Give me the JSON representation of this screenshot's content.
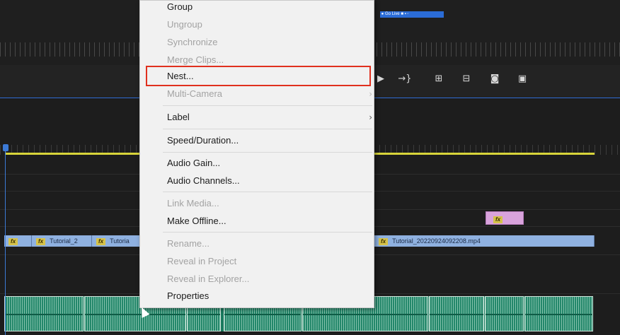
{
  "context_menu": {
    "items": {
      "group": "Group",
      "ungroup": "Ungroup",
      "synchronize": "Synchronize",
      "merge_clips": "Merge Clips...",
      "nest": "Nest...",
      "multi_camera": "Multi-Camera",
      "label": "Label",
      "speed_duration": "Speed/Duration...",
      "audio_gain": "Audio Gain...",
      "audio_channels": "Audio Channels...",
      "link_media": "Link Media...",
      "make_offline": "Make Offline...",
      "rename": "Rename...",
      "reveal_in_project": "Reveal in Project",
      "reveal_in_explorer": "Reveal in Explorer...",
      "properties": "Properties"
    },
    "highlighted_item": "nest",
    "highlight_color": "#e0301e"
  },
  "timeline": {
    "clips": {
      "clip_2": "Tutorial_2",
      "clip_3": "Tutoria",
      "clip_main": "Tutorial_20220924092208.mp4"
    },
    "fx_label": "fx"
  },
  "status_strip": "Go Live",
  "colors": {
    "video_clip": "#8fb1e0",
    "audio_clip": "#23876a",
    "work_area": "#d7d43a",
    "playhead": "#3c7ad6"
  }
}
